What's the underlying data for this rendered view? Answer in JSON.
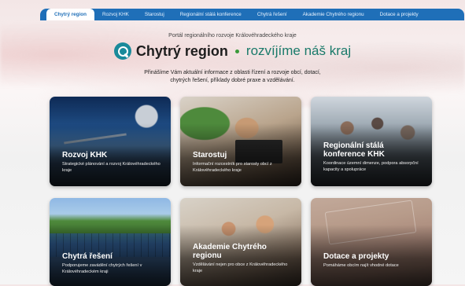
{
  "nav": {
    "items": [
      {
        "label": "Chytrý region",
        "active": true
      },
      {
        "label": "Rozvoj KHK"
      },
      {
        "label": "Starostuj"
      },
      {
        "label": "Regionální stálá konference"
      },
      {
        "label": "Chytrá řešení"
      },
      {
        "label": "Akademie Chytrého regionu"
      },
      {
        "label": "Dotace a projekty"
      }
    ]
  },
  "hero": {
    "subtitle": "Portál regionálního rozvoje Královéhradeckého kraje",
    "brand_name": "Chytrý region",
    "slogan": "rozvíjíme náš kraj",
    "intro_line1": "Přinášíme Vám aktuální informace z oblasti řízení a rozvoje obcí, dotací,",
    "intro_line2": "chytrých řešení, příklady dobré praxe a vzdělávání.",
    "logo_icon": "search-magnifier-icon",
    "accent_color": "#1a8a9a",
    "slogan_color": "#1a7a6a"
  },
  "cards": [
    {
      "title": "Rozvoj KHK",
      "desc": "Strategické plánování a rozvoj Královéhradeckého kraje"
    },
    {
      "title": "Starostuj",
      "desc": "Informační rozcestník pro starosty obcí z Královéhradeckého kraje"
    },
    {
      "title_line1": "Regionální stálá",
      "title_line2": "konference KHK",
      "desc": "Koordinace územní dimenze, podpora absorpční kapacity a spolupráce"
    },
    {
      "title": "Chytrá řešení",
      "desc": "Podporujeme zavádění chytrých řešení v Královéhradeckém kraji"
    },
    {
      "title_line1": "Akademie Chytrého",
      "title_line2": "regionu",
      "desc": "Vzdělávání nejen pro obce z Královéhradeckého kraje"
    },
    {
      "title": "Dotace a projekty",
      "desc": "Pomáháme obcím najít vhodné dotace"
    }
  ],
  "colors": {
    "nav_bg": "#1f6fb8",
    "nav_active_text": "#1f6fb8"
  }
}
